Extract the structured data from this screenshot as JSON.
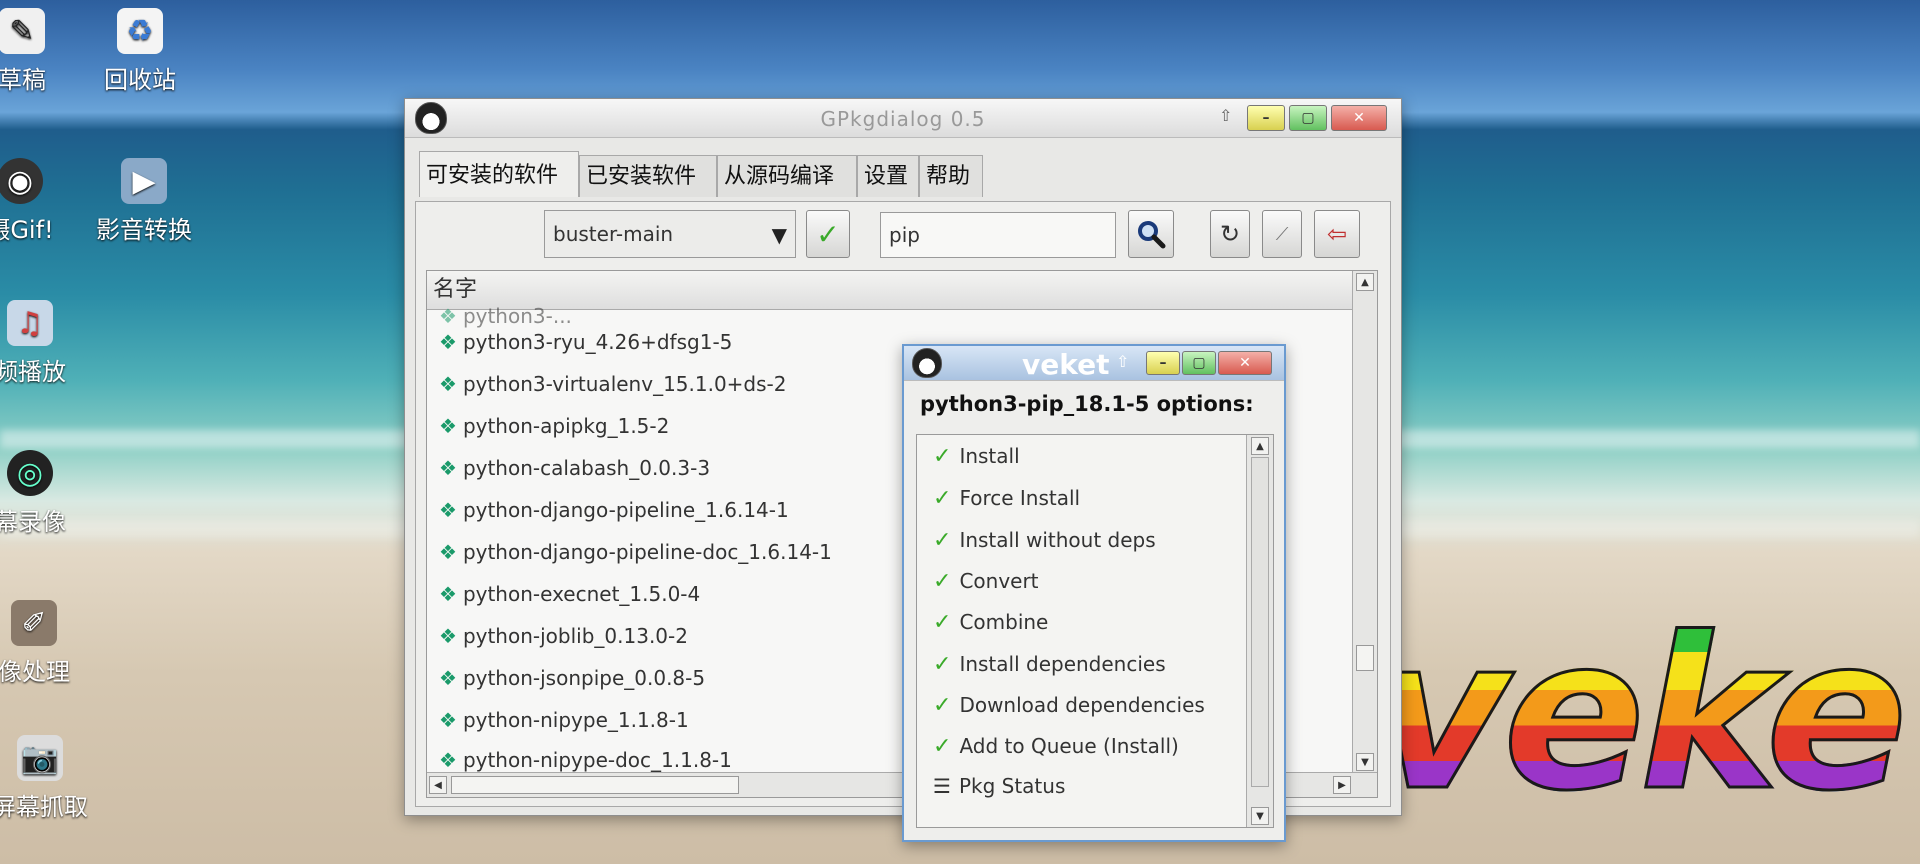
{
  "desktop": {
    "icons": [
      {
        "label": "草稿",
        "icon": "scratch-icon"
      },
      {
        "label": "回收站",
        "icon": "recycle-bin-icon"
      },
      {
        "label": "摄Gif!",
        "icon": "gif-recorder-icon"
      },
      {
        "label": "影音转换",
        "icon": "video-converter-icon"
      },
      {
        "label": "频播放",
        "icon": "media-player-icon"
      },
      {
        "label": "幕录像",
        "icon": "screen-recorder-icon"
      },
      {
        "label": "像处理",
        "icon": "gimp-icon"
      },
      {
        "label": "屏幕抓取",
        "icon": "screenshot-icon"
      }
    ],
    "logo_text": "veke"
  },
  "gpkg": {
    "title": "GPkgdialog 0.5",
    "tabs": [
      {
        "label": "可安装的软件",
        "active": true
      },
      {
        "label": "已安装软件",
        "active": false
      },
      {
        "label": "从源码编译",
        "active": false
      },
      {
        "label": "设置",
        "active": false
      },
      {
        "label": "帮助",
        "active": false
      }
    ],
    "repo_select": "buster-main",
    "search_value": "pip",
    "column_header": "名字",
    "packages": [
      "python3-ryu_4.26+dfsg1-5",
      "python3-virtualenv_15.1.0+ds-2",
      "python-apipkg_1.5-2",
      "python-calabash_0.0.3-3",
      "python-django-pipeline_1.6.14-1",
      "python-django-pipeline-doc_1.6.14-1",
      "python-execnet_1.5.0-4",
      "python-joblib_0.13.0-2",
      "python-jsonpipe_0.0.8-5",
      "python-nipype_1.1.8-1",
      "python-nipype-doc_1.1.8-1"
    ]
  },
  "veket_dialog": {
    "title": "veket",
    "heading": "python3-pip_18.1-5 options:",
    "options": [
      {
        "label": "Install",
        "icon": "check-icon"
      },
      {
        "label": "Force Install",
        "icon": "check-icon"
      },
      {
        "label": "Install without deps",
        "icon": "check-icon"
      },
      {
        "label": "Convert",
        "icon": "check-icon"
      },
      {
        "label": "Combine",
        "icon": "check-icon"
      },
      {
        "label": "Install dependencies",
        "icon": "check-icon"
      },
      {
        "label": "Download dependencies",
        "icon": "check-icon"
      },
      {
        "label": "Add to Queue (Install)",
        "icon": "check-icon"
      },
      {
        "label": "Pkg Status",
        "icon": "list-icon"
      }
    ]
  }
}
